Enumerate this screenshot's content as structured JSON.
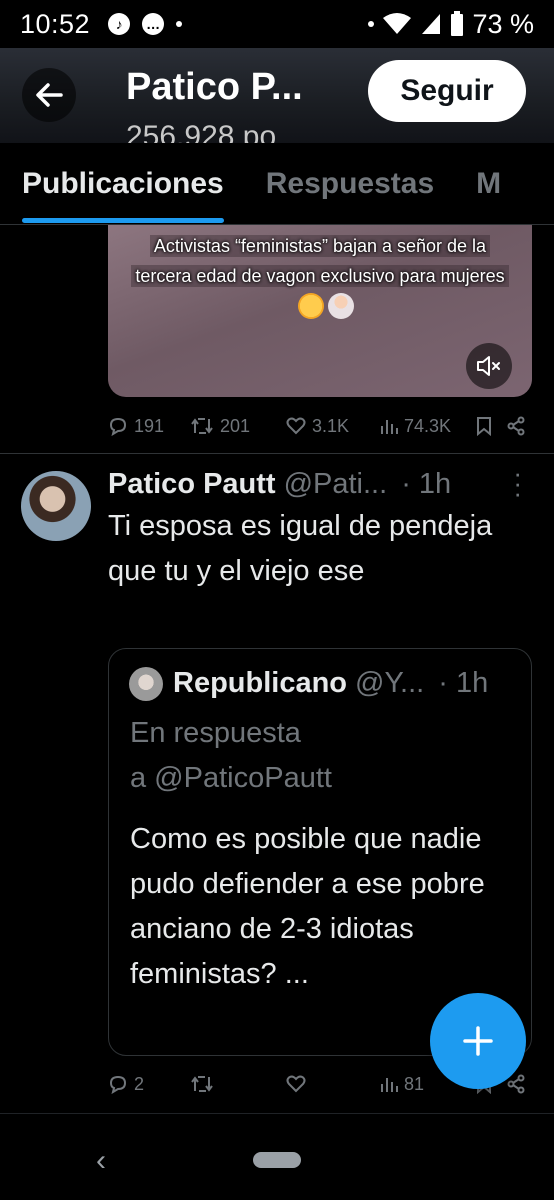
{
  "status_bar": {
    "time": "10:52",
    "battery": "73 %"
  },
  "header": {
    "title": "Patico P...",
    "subtitle": "256.928 po",
    "follow_label": "Seguir"
  },
  "tabs": [
    {
      "label": "Publicaciones",
      "active": true
    },
    {
      "label": "Respuestas",
      "active": false
    },
    {
      "label": "M",
      "active": false
    }
  ],
  "video": {
    "caption_line1": "Activistas “feministas” bajan a señor de la",
    "caption_line2": "tercera edad de vagon exclusivo para mujeres"
  },
  "post1_actions": {
    "replies": "191",
    "reposts": "201",
    "likes": "3.1K",
    "views": "74.3K"
  },
  "tweet": {
    "name": "Patico Pautt",
    "handle": "@Pati...",
    "time": "· 1h",
    "text": "Ti esposa es igual de pendeja que tu y el viejo ese"
  },
  "quote": {
    "name": "Republicano",
    "handle": "@Y...",
    "time": "· 1h",
    "reply_line1": "En respuesta",
    "reply_line2": "a @PaticoPautt",
    "text": "Como es posible que nadie pudo defiender a ese pobre anciano de 2-3 idiotas feministas? ..."
  },
  "post2_actions": {
    "replies": "2",
    "reposts": "",
    "likes": "",
    "views": "81"
  },
  "colors": {
    "accent": "#1d9bf0",
    "background": "#000000",
    "muted": "#71767b",
    "text": "#e7e9ea"
  },
  "icons": [
    "back-arrow-icon",
    "mute-icon",
    "reply-icon",
    "repost-icon",
    "like-icon",
    "views-icon",
    "bookmark-icon",
    "share-icon",
    "more-icon",
    "compose-plus-icon"
  ]
}
